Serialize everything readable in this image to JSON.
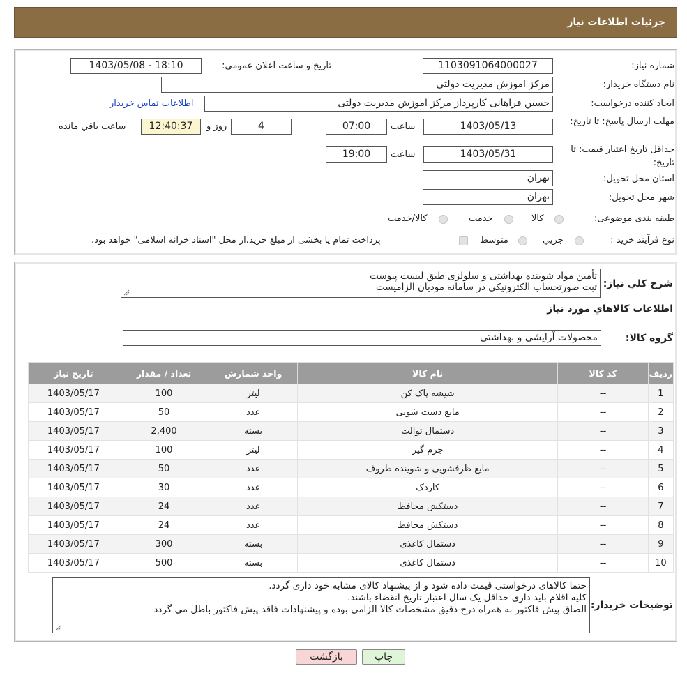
{
  "header": {
    "title": "جزئیات اطلاعات نیاز"
  },
  "info": {
    "need_number_label": "شماره نیاز:",
    "need_number": "1103091064000027",
    "announce_label": "تاریخ و ساعت اعلان عمومی:",
    "announce_value": "1403/05/08 - 18:10",
    "buyer_org_label": "نام دستگاه خریدار:",
    "buyer_org": "مرکز اموزش مدیریت دولتی",
    "creator_label": "ایجاد کننده درخواست:",
    "creator": "حسین  فراهانی کارپرداز مرکز اموزش مدیریت دولتی",
    "contact_link": "اطلاعات تماس خریدار",
    "deadline_label": "مهلت ارسال پاسخ: تا تاریخ:",
    "deadline_date": "1403/05/13",
    "time_label": "ساعت",
    "deadline_time": "07:00",
    "days_value": "4",
    "days_label": "روز و",
    "remaining_value": "12:40:37",
    "remaining_label": "ساعت باقي مانده",
    "validity_label": "حداقل تاریخ اعتبار قیمت: تا تاریخ:",
    "validity_date": "1403/05/31",
    "validity_time_label": "ساعت",
    "validity_time": "19:00",
    "province_label": "استان محل تحویل:",
    "province": "تهران",
    "city_label": "شهر محل تحویل:",
    "city": "تهران",
    "category_label": "طبقه بندی موضوعی:",
    "category_options": [
      "کالا",
      "خدمت",
      "کالا/خدمت"
    ],
    "process_label": "نوع فرآیند خرید :",
    "process_options": [
      "جزيي",
      "متوسط"
    ],
    "process_note": "پرداخت تمام یا بخشی از مبلغ خرید،از محل \"اسناد خزانه اسلامی\" خواهد بود."
  },
  "description": {
    "label": "شرح کلي نياز:",
    "lines": [
      "تأمین مواد شوینده بهداشتی و سلولزی طبق لیست پیوست",
      "ثبت صورتحساب الکترونیکی در سامانه مودیان الزامیست"
    ]
  },
  "goods": {
    "section_title": "اطلاعات کالاهاي مورد نياز",
    "group_label": "گروه کالا:",
    "group_value": "محصولات آرایشی و بهداشتی"
  },
  "table": {
    "headers": [
      "ردیف",
      "کد کالا",
      "نام کالا",
      "واحد شمارش",
      "تعداد / مقدار",
      "تاریخ نیاز"
    ],
    "rows": [
      [
        "1",
        "--",
        "شیشه پاک کن",
        "لیتر",
        "100",
        "1403/05/17"
      ],
      [
        "2",
        "--",
        "مایع دست شویی",
        "عدد",
        "50",
        "1403/05/17"
      ],
      [
        "3",
        "--",
        "دستمال توالت",
        "بسته",
        "2,400",
        "1403/05/17"
      ],
      [
        "4",
        "--",
        "جرم گیر",
        "لیتر",
        "100",
        "1403/05/17"
      ],
      [
        "5",
        "--",
        "مایع ظرفشویی و شوینده ظروف",
        "عدد",
        "50",
        "1403/05/17"
      ],
      [
        "6",
        "--",
        "کاردک",
        "عدد",
        "30",
        "1403/05/17"
      ],
      [
        "7",
        "--",
        "دستکش محافظ",
        "عدد",
        "24",
        "1403/05/17"
      ],
      [
        "8",
        "--",
        "دستکش محافظ",
        "عدد",
        "24",
        "1403/05/17"
      ],
      [
        "9",
        "--",
        "دستمال کاغذی",
        "بسته",
        "300",
        "1403/05/17"
      ],
      [
        "10",
        "--",
        "دستمال کاغذی",
        "بسته",
        "500",
        "1403/05/17"
      ]
    ]
  },
  "buyer_notes": {
    "label": "توضیحات خریدار:",
    "lines": [
      "حتما کالاهای درخواستی قیمت داده شود و از پیشنهاد کالای مشابه خود داری گردد.",
      "کلیه اقلام باید داری حداقل یک سال اعتبار تاریخ انقضاء باشند.",
      "الصاق پیش فاکتور به همراه درج دقیق مشخصات کالا الزامی بوده و پیشنهادات فاقد پیش فاکتور باطل می گردد"
    ]
  },
  "buttons": {
    "print": "چاپ",
    "back": "بازگشت"
  },
  "colors": {
    "header_bg": "#8b6d43",
    "table_header_bg": "#9c9c9c",
    "back_btn_bg": "#f9d6d6",
    "print_btn_bg": "#dff5d8",
    "link": "#1a3fc7"
  }
}
